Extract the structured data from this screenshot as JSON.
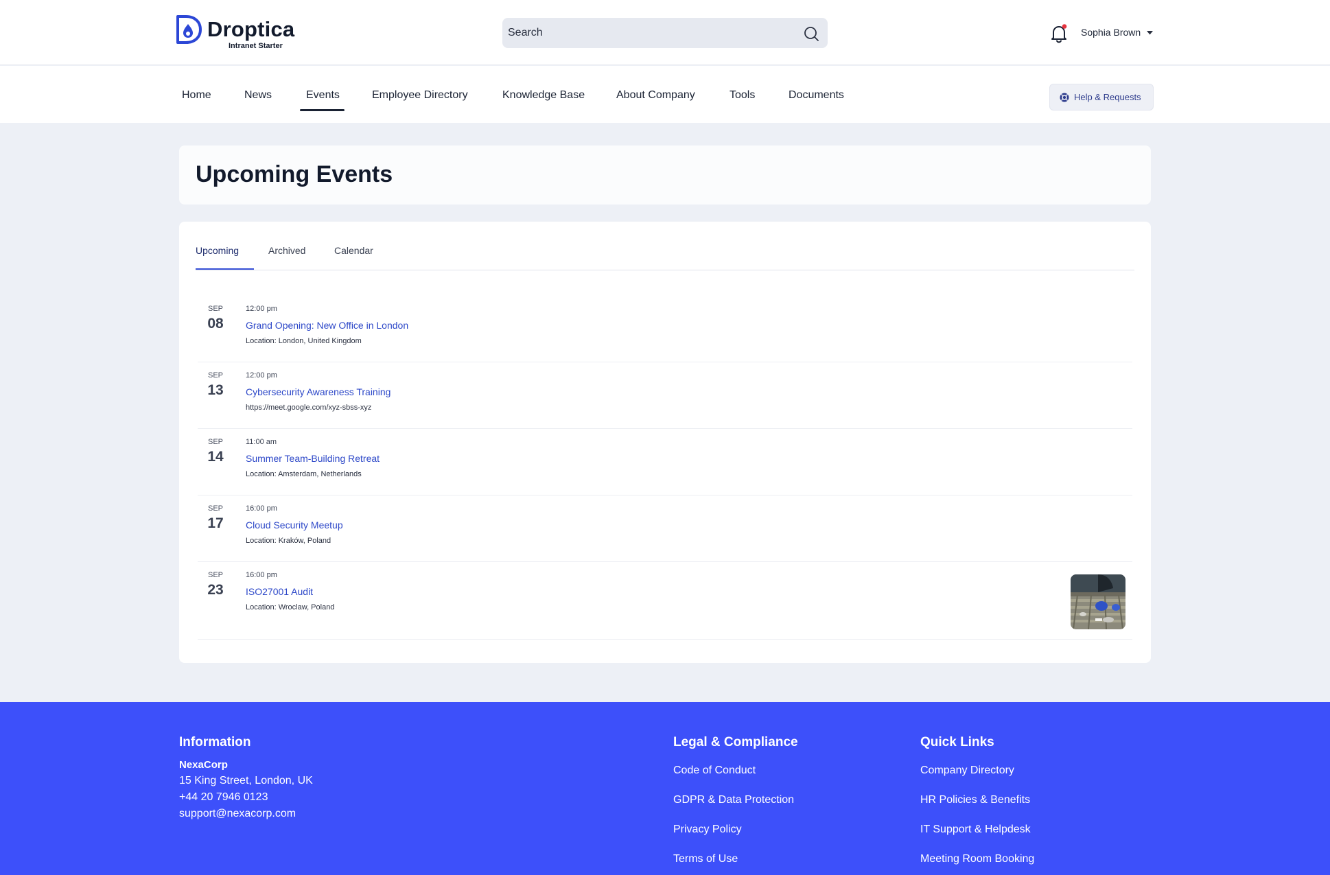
{
  "brand": {
    "name": "Droptica",
    "subtitle": "Intranet Starter",
    "accent": "#3d50fa",
    "link_color": "#2c47c8"
  },
  "header": {
    "search_placeholder": "Search",
    "user_name": "Sophia Brown",
    "notification_dot_color": "#e5343f"
  },
  "nav": {
    "items": [
      {
        "label": "Home"
      },
      {
        "label": "News"
      },
      {
        "label": "Events",
        "active": true
      },
      {
        "label": "Employee Directory"
      },
      {
        "label": "Knowledge Base"
      },
      {
        "label": "About Company"
      },
      {
        "label": "Tools"
      },
      {
        "label": "Documents"
      }
    ],
    "help_label": "Help & Requests"
  },
  "page": {
    "title": "Upcoming Events"
  },
  "tabs": [
    {
      "label": "Upcoming",
      "active": true
    },
    {
      "label": "Archived"
    },
    {
      "label": "Calendar"
    }
  ],
  "events": [
    {
      "month": "SEP",
      "day": "08",
      "time": "12:00 pm",
      "title": "Grand Opening: New Office in London",
      "location": "Location: London, United Kingdom"
    },
    {
      "month": "SEP",
      "day": "13",
      "time": "12:00 pm",
      "title": "Cybersecurity Awareness Training",
      "location": "https://meet.google.com/xyz-sbss-xyz"
    },
    {
      "month": "SEP",
      "day": "14",
      "time": "11:00 am",
      "title": "Summer Team-Building Retreat",
      "location": "Location: Amsterdam, Netherlands"
    },
    {
      "month": "SEP",
      "day": "17",
      "time": "16:00 pm",
      "title": "Cloud Security Meetup",
      "location": "Location: Kraków, Poland"
    },
    {
      "month": "SEP",
      "day": "23",
      "time": "16:00 pm",
      "title": "ISO27001 Audit",
      "location": "Location: Wroclaw, Poland",
      "has_thumbnail": true
    }
  ],
  "footer": {
    "information": {
      "heading": "Information",
      "company": "NexaCorp",
      "address": "15 King Street, London, UK",
      "phone": "+44 20 7946 0123",
      "email": "support@nexacorp.com"
    },
    "legal": {
      "heading": "Legal & Compliance",
      "links": [
        "Code of Conduct",
        "GDPR & Data Protection",
        "Privacy Policy",
        "Terms of Use"
      ]
    },
    "quick_links": {
      "heading": "Quick Links",
      "links": [
        "Company Directory",
        "HR Policies & Benefits",
        "IT Support & Helpdesk",
        "Meeting Room Booking"
      ]
    }
  }
}
